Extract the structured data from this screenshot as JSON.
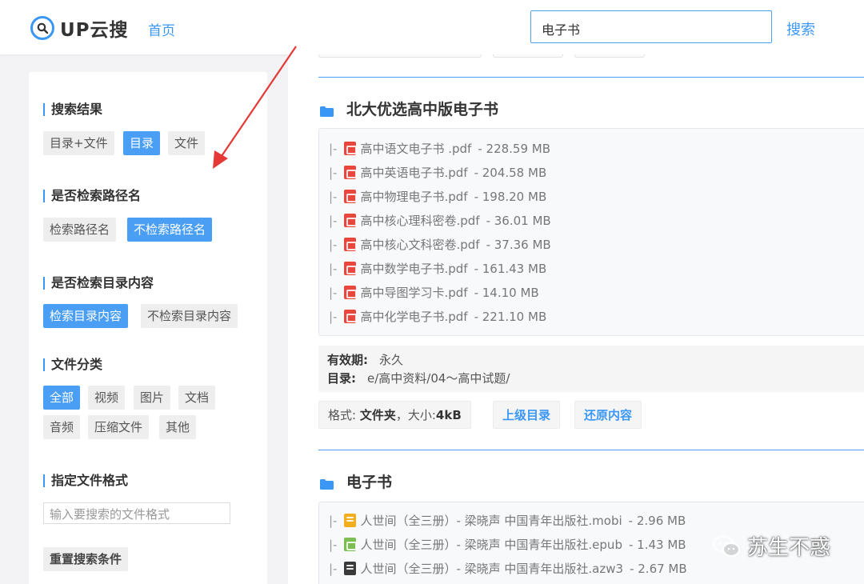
{
  "app": {
    "logo_text": "UP云搜",
    "nav_home": "首页",
    "search_value": "电子书",
    "search_button": "搜索",
    "accent_color": "#3b97f5"
  },
  "sidebar": {
    "sections": [
      {
        "title": "搜索结果",
        "options": [
          {
            "label": "目录+文件",
            "active": false
          },
          {
            "label": "目录",
            "active": true
          },
          {
            "label": "文件",
            "active": false
          }
        ]
      },
      {
        "title": "是否检索路径名",
        "options": [
          {
            "label": "检索路径名",
            "active": false
          },
          {
            "label": "不检索路径名",
            "active": true
          }
        ]
      },
      {
        "title": "是否检索目录内容",
        "options": [
          {
            "label": "检索目录内容",
            "active": true
          },
          {
            "label": "不检索目录内容",
            "active": false
          }
        ]
      },
      {
        "title": "文件分类",
        "options": [
          {
            "label": "全部",
            "active": true
          },
          {
            "label": "视频",
            "active": false
          },
          {
            "label": "图片",
            "active": false
          },
          {
            "label": "文档",
            "active": false
          },
          {
            "label": "音频",
            "active": false
          },
          {
            "label": "压缩文件",
            "active": false
          },
          {
            "label": "其他",
            "active": false
          }
        ]
      },
      {
        "title": "指定文件格式"
      }
    ],
    "format_placeholder": "输入要搜索的文件格式",
    "reset_button": "重置搜索条件"
  },
  "results": [
    {
      "title": "北大优选高中版电子书",
      "prefix": "|-",
      "files": [
        {
          "name": "高中语文电子书 .pdf",
          "size": "- 228.59 MB",
          "icon": "pdf-icon"
        },
        {
          "name": "高中英语电子书.pdf",
          "size": "- 204.58 MB",
          "icon": "pdf-icon"
        },
        {
          "name": "高中物理电子书.pdf",
          "size": "- 198.20 MB",
          "icon": "pdf-icon"
        },
        {
          "name": "高中核心理科密卷.pdf",
          "size": "- 36.01 MB",
          "icon": "pdf-icon"
        },
        {
          "name": "高中核心文科密卷.pdf",
          "size": "- 37.36 MB",
          "icon": "pdf-icon"
        },
        {
          "name": "高中数学电子书.pdf",
          "size": "- 161.43 MB",
          "icon": "pdf-icon"
        },
        {
          "name": "高中导图学习卡.pdf",
          "size": "- 14.10 MB",
          "icon": "pdf-icon"
        },
        {
          "name": "高中化学电子书.pdf",
          "size": "- 221.10 MB",
          "icon": "pdf-icon"
        }
      ],
      "validity_label": "有效期:",
      "validity_value": "永久",
      "dir_label": "目录:",
      "dir_value": "e/高中资料/04～高中试题/",
      "format_prefix": "格式:",
      "format_value": "文件夹",
      "size_prefix": "，大小:",
      "size_value": "4kB",
      "parent_link": "上级目录",
      "restore_link": "还原内容"
    },
    {
      "title": "电子书",
      "prefix": "|-",
      "files": [
        {
          "name": "人世间（全三册）- 梁晓声 中国青年出版社.mobi",
          "size": "- 2.96 MB",
          "icon": "mobi-icon"
        },
        {
          "name": "人世间（全三册）- 梁晓声 中国青年出版社.epub",
          "size": "- 1.43 MB",
          "icon": "epub-icon"
        },
        {
          "name": "人世间（全三册）- 梁晓声 中国青年出版社.azw3",
          "size": "- 2.67 MB",
          "icon": "azw3-icon"
        }
      ]
    }
  ],
  "watermark": "苏生不惑"
}
